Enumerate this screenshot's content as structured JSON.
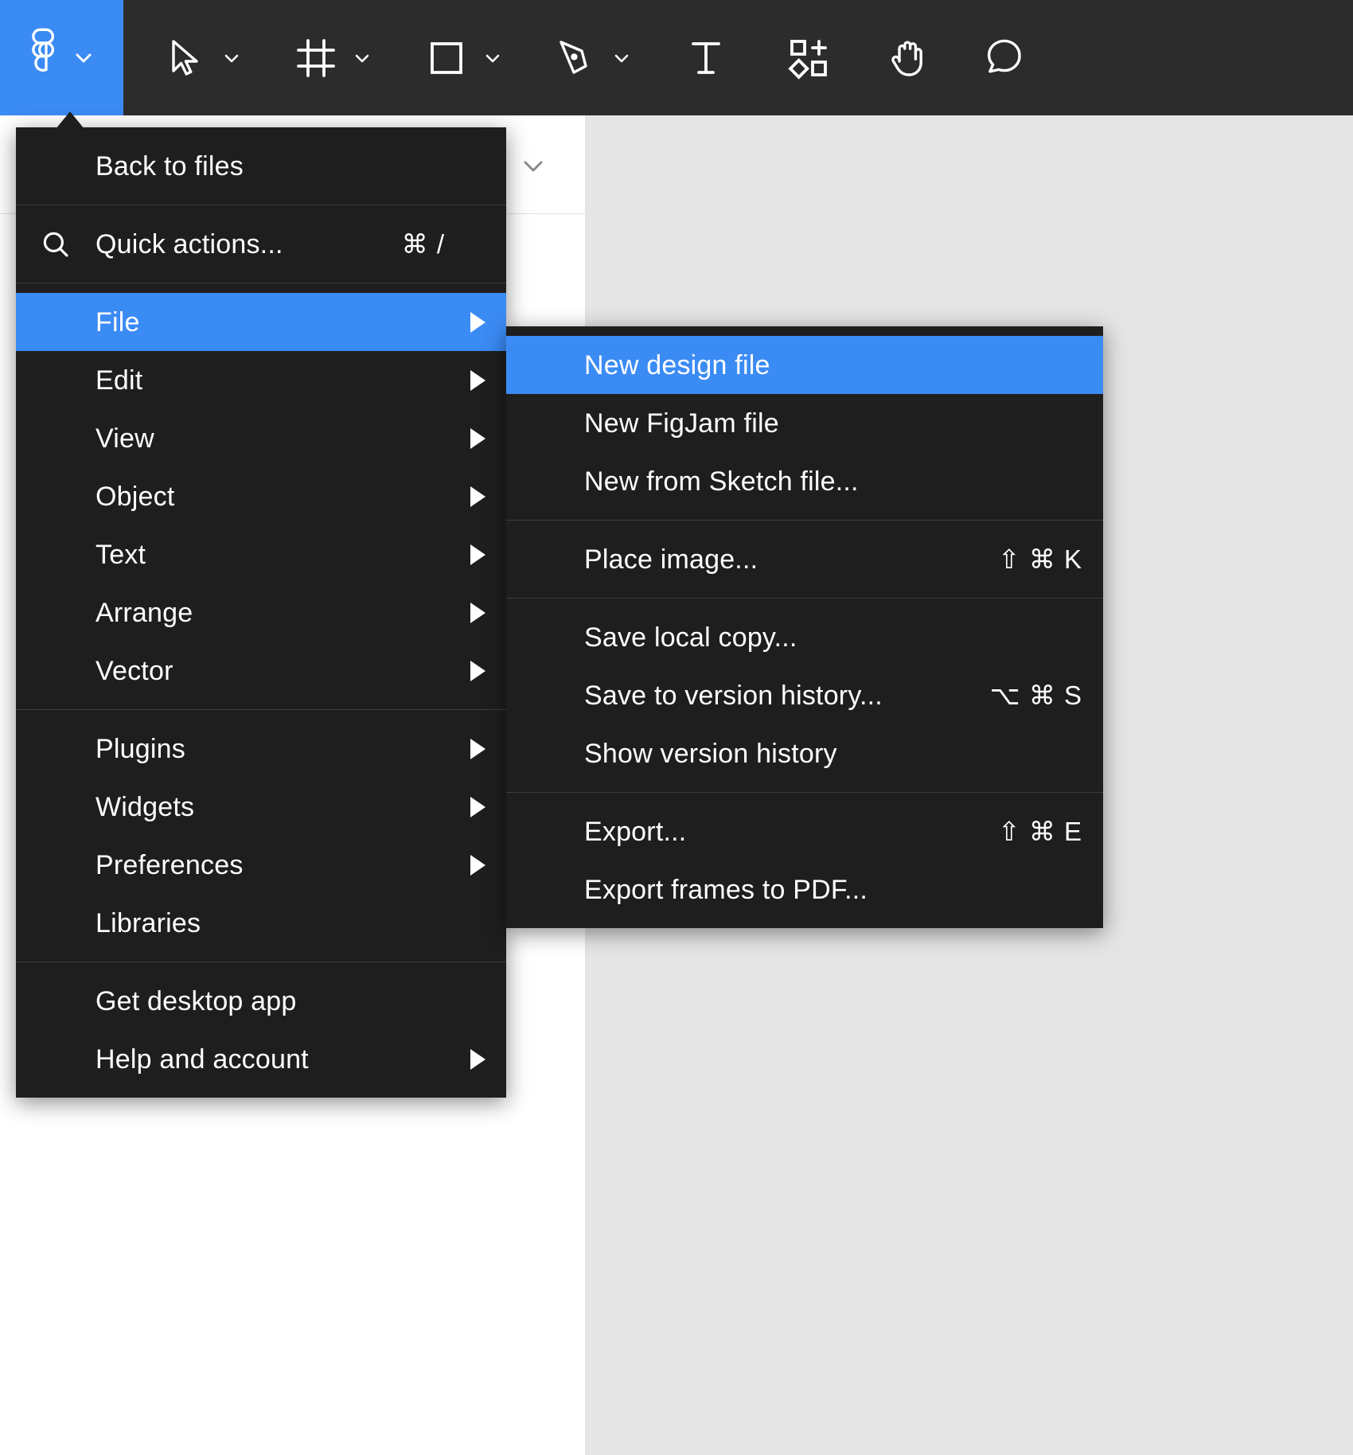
{
  "app": {
    "name": "Figma",
    "accent_color": "#3b8bf5",
    "menu_background": "#1e1e1e",
    "toolbar_background": "#2c2c2c"
  },
  "toolbar": {
    "items": [
      {
        "name": "figma-logo",
        "icon": "figma-logo-icon",
        "has_chevron": true,
        "active": true
      },
      {
        "name": "move-tool",
        "icon": "cursor-arrow-icon",
        "has_chevron": true,
        "active": false
      },
      {
        "name": "frame-tool",
        "icon": "frame-grid-icon",
        "has_chevron": true,
        "active": false
      },
      {
        "name": "shape-tool",
        "icon": "square-icon",
        "has_chevron": true,
        "active": false
      },
      {
        "name": "pen-tool",
        "icon": "pen-nib-icon",
        "has_chevron": true,
        "active": false
      },
      {
        "name": "text-tool",
        "icon": "text-t-icon",
        "has_chevron": false,
        "active": false
      },
      {
        "name": "resources-tool",
        "icon": "components-plus-icon",
        "has_chevron": false,
        "active": false
      },
      {
        "name": "hand-tool",
        "icon": "hand-icon",
        "has_chevron": false,
        "active": false
      },
      {
        "name": "comment-tool",
        "icon": "comment-bubble-icon",
        "has_chevron": false,
        "active": false
      }
    ]
  },
  "main_menu": {
    "sections": [
      {
        "items": [
          {
            "label": "Back to files",
            "icon": "",
            "shortcut": "",
            "has_submenu": false,
            "highlight": false
          }
        ]
      },
      {
        "items": [
          {
            "label": "Quick actions...",
            "icon": "search-icon",
            "shortcut": "⌘ /",
            "has_submenu": false,
            "highlight": false
          }
        ]
      },
      {
        "items": [
          {
            "label": "File",
            "icon": "",
            "shortcut": "",
            "has_submenu": true,
            "highlight": true
          },
          {
            "label": "Edit",
            "icon": "",
            "shortcut": "",
            "has_submenu": true,
            "highlight": false
          },
          {
            "label": "View",
            "icon": "",
            "shortcut": "",
            "has_submenu": true,
            "highlight": false
          },
          {
            "label": "Object",
            "icon": "",
            "shortcut": "",
            "has_submenu": true,
            "highlight": false
          },
          {
            "label": "Text",
            "icon": "",
            "shortcut": "",
            "has_submenu": true,
            "highlight": false
          },
          {
            "label": "Arrange",
            "icon": "",
            "shortcut": "",
            "has_submenu": true,
            "highlight": false
          },
          {
            "label": "Vector",
            "icon": "",
            "shortcut": "",
            "has_submenu": true,
            "highlight": false
          }
        ]
      },
      {
        "items": [
          {
            "label": "Plugins",
            "icon": "",
            "shortcut": "",
            "has_submenu": true,
            "highlight": false
          },
          {
            "label": "Widgets",
            "icon": "",
            "shortcut": "",
            "has_submenu": true,
            "highlight": false
          },
          {
            "label": "Preferences",
            "icon": "",
            "shortcut": "",
            "has_submenu": true,
            "highlight": false
          },
          {
            "label": "Libraries",
            "icon": "",
            "shortcut": "",
            "has_submenu": false,
            "highlight": false
          }
        ]
      },
      {
        "items": [
          {
            "label": "Get desktop app",
            "icon": "",
            "shortcut": "",
            "has_submenu": false,
            "highlight": false
          },
          {
            "label": "Help and account",
            "icon": "",
            "shortcut": "",
            "has_submenu": true,
            "highlight": false
          }
        ]
      }
    ]
  },
  "file_submenu": {
    "sections": [
      {
        "items": [
          {
            "label": "New design file",
            "shortcut": "",
            "highlight": true
          },
          {
            "label": "New FigJam file",
            "shortcut": "",
            "highlight": false
          },
          {
            "label": "New from Sketch file...",
            "shortcut": "",
            "highlight": false
          }
        ]
      },
      {
        "items": [
          {
            "label": "Place image...",
            "shortcut": "⇧ ⌘ K",
            "highlight": false
          }
        ]
      },
      {
        "items": [
          {
            "label": "Save local copy...",
            "shortcut": "",
            "highlight": false
          },
          {
            "label": "Save to version history...",
            "shortcut": "⌥ ⌘ S",
            "highlight": false
          },
          {
            "label": "Show version history",
            "shortcut": "",
            "highlight": false
          }
        ]
      },
      {
        "items": [
          {
            "label": "Export...",
            "shortcut": "⇧ ⌘ E",
            "highlight": false
          },
          {
            "label": "Export frames to PDF...",
            "shortcut": "",
            "highlight": false
          }
        ]
      }
    ]
  }
}
